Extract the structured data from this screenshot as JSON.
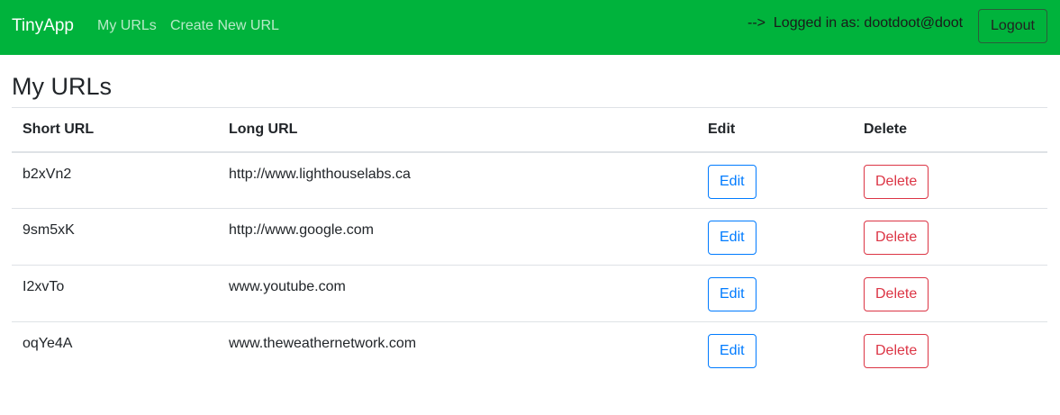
{
  "navbar": {
    "brand": "TinyApp",
    "links": [
      {
        "label": "My URLs"
      },
      {
        "label": "Create New URL"
      }
    ],
    "login_text": "-->  Logged in as: dootdoot@doot",
    "logout_label": "Logout",
    "background_color": "#00b33c"
  },
  "main": {
    "title": "My URLs",
    "table": {
      "headers": [
        "Short URL",
        "Long URL",
        "Edit",
        "Delete"
      ],
      "rows": [
        {
          "short": "b2xVn2",
          "long": "http://www.lighthouselabs.ca",
          "edit": "Edit",
          "delete": "Delete"
        },
        {
          "short": "9sm5xK",
          "long": "http://www.google.com",
          "edit": "Edit",
          "delete": "Delete"
        },
        {
          "short": "I2xvTo",
          "long": "www.youtube.com",
          "edit": "Edit",
          "delete": "Delete"
        },
        {
          "short": "oqYe4A",
          "long": "www.theweathernetwork.com",
          "edit": "Edit",
          "delete": "Delete"
        }
      ]
    }
  },
  "colors": {
    "edit": "#007bff",
    "delete": "#dc3545"
  }
}
